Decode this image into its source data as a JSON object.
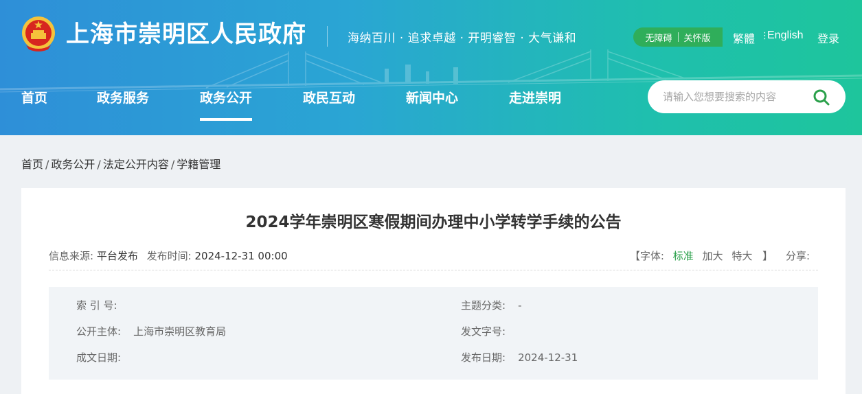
{
  "header": {
    "site_title": "上海市崇明区人民政府",
    "slogan": "海纳百川 · 追求卓越 · 开明睿智 · 大气谦和",
    "accessibility": "无障碍",
    "care_mode": "关怀版",
    "lang_traditional": "繁體",
    "lang_english": "English",
    "login": "登录"
  },
  "nav": {
    "items": [
      {
        "label": "首页"
      },
      {
        "label": "政务服务"
      },
      {
        "label": "政务公开"
      },
      {
        "label": "政民互动"
      },
      {
        "label": "新闻中心"
      },
      {
        "label": "走进崇明"
      }
    ],
    "active": "政务公开"
  },
  "search": {
    "placeholder": "请输入您想要搜索的内容"
  },
  "breadcrumb": [
    "首页",
    "政务公开",
    "法定公开内容",
    "学籍管理"
  ],
  "article": {
    "title": "2024学年崇明区寒假期间办理中小学转学手续的公告",
    "source_label": "信息来源:",
    "source_value": "平台发布",
    "time_label": "发布时间:",
    "time_value": "2024-12-31 00:00",
    "font_label": "【字体:",
    "font_standard": "标准",
    "font_large": "加大",
    "font_xlarge": "特大",
    "font_close": "】",
    "share_label": "分享:"
  },
  "info": {
    "index_label": "索 引 号:",
    "index_value": "",
    "topic_label": "主题分类:",
    "topic_value": "-",
    "publisher_label": "公开主体:",
    "publisher_value": "上海市崇明区教育局",
    "doc_no_label": "发文字号:",
    "doc_no_value": "",
    "written_date_label": "成文日期:",
    "written_date_value": "",
    "publish_date_label": "发布日期:",
    "publish_date_value": "2024-12-31"
  },
  "colors": {
    "header_gradient_start": "#2e8fd8",
    "header_gradient_end": "#1ec59c",
    "care_pill": "#2fae5a",
    "accent_green": "#2aa04a",
    "emblem_red": "#d7261f",
    "emblem_gold": "#f5c33b"
  }
}
